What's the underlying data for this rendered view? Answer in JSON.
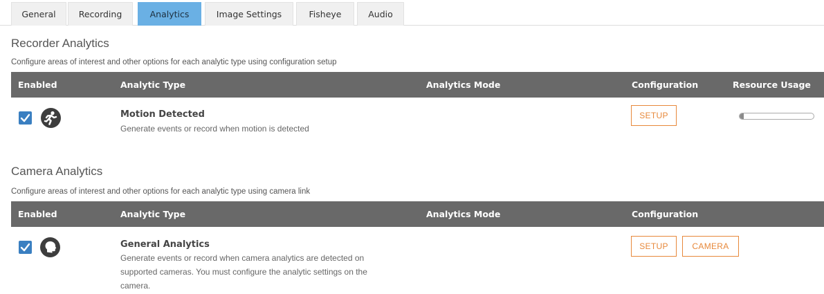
{
  "tabs": [
    {
      "label": "General"
    },
    {
      "label": "Recording"
    },
    {
      "label": "Analytics",
      "active": true
    },
    {
      "label": "Image Settings"
    },
    {
      "label": "Fisheye"
    },
    {
      "label": "Audio"
    }
  ],
  "recorder": {
    "title": "Recorder Analytics",
    "description": "Configure areas of interest and other options for each analytic type using configuration setup",
    "columns": {
      "enabled": "Enabled",
      "type": "Analytic Type",
      "mode": "Analytics Mode",
      "config": "Configuration",
      "resource": "Resource Usage"
    },
    "row": {
      "enabled": true,
      "icon": "running-person-icon",
      "name": "Motion Detected",
      "description": "Generate events or record when motion is detected",
      "setup_label": "SETUP",
      "resource_usage_fraction": 0.06
    }
  },
  "camera": {
    "title": "Camera Analytics",
    "description": "Configure areas of interest and other options for each analytic type using camera link",
    "columns": {
      "enabled": "Enabled",
      "type": "Analytic Type",
      "mode": "Analytics Mode",
      "config": "Configuration"
    },
    "row": {
      "enabled": true,
      "icon": "head-profile-icon",
      "name": "General Analytics",
      "description_lines": [
        "Generate events or record when camera analytics are detected on",
        "supported cameras. You must configure the analytic settings on the",
        "camera."
      ],
      "setup_label": "SETUP",
      "camera_label": "CAMERA"
    }
  },
  "colors": {
    "tab_active": "#6ab0e4",
    "header_bg": "#696969",
    "checkbox": "#3a7fc1",
    "button_accent": "#e7883a"
  }
}
